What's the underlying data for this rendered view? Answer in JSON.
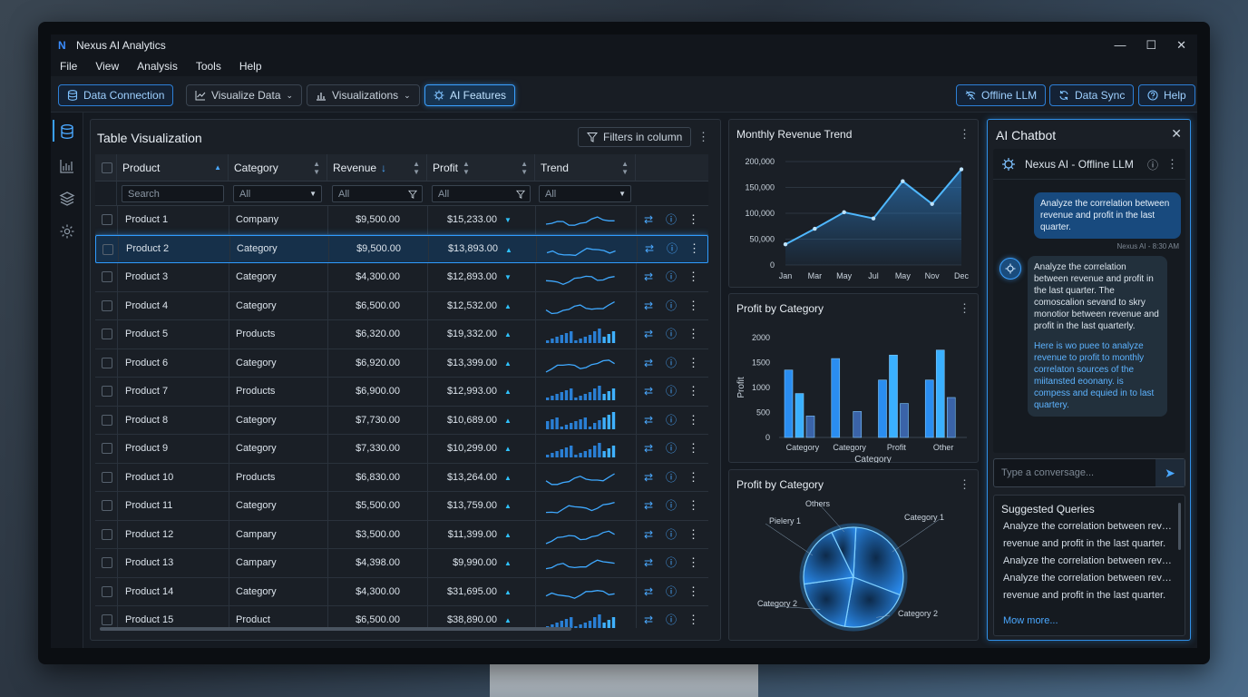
{
  "app": {
    "title": "Nexus AI Analytics",
    "logo_letter": "N"
  },
  "menu": [
    "File",
    "View",
    "Analysis",
    "Tools",
    "Help"
  ],
  "toolbar": {
    "data_connection": "Data Connection",
    "visualize_data": "Visualize Data",
    "visualizations": "Visualizations",
    "ai_features": "AI Features",
    "offline_llm": "Offline LLM",
    "data_sync": "Data Sync",
    "help": "Help"
  },
  "table": {
    "title": "Table Visualization",
    "filters_label": "Filters in column",
    "columns": [
      "Product",
      "Category",
      "Revenue",
      "Profit",
      "Trend"
    ],
    "filters": {
      "product_placeholder": "Search",
      "category": "All",
      "revenue": "All",
      "profit": "All",
      "trend": "All"
    },
    "rows": [
      {
        "product": "Product 1",
        "category": "Company",
        "revenue": "$9,500.00",
        "profit": "$15,233.00",
        "dir": "down",
        "spark": "line",
        "selected": false
      },
      {
        "product": "Product 2",
        "category": "Category",
        "revenue": "$9,500.00",
        "profit": "$13,893.00",
        "dir": "up",
        "spark": "line",
        "selected": true
      },
      {
        "product": "Product 3",
        "category": "Category",
        "revenue": "$4,300.00",
        "profit": "$12,893.00",
        "dir": "down",
        "spark": "line",
        "selected": false
      },
      {
        "product": "Product 4",
        "category": "Category",
        "revenue": "$6,500.00",
        "profit": "$12,532.00",
        "dir": "up",
        "spark": "line",
        "selected": false
      },
      {
        "product": "Product 5",
        "category": "Products",
        "revenue": "$6,320.00",
        "profit": "$19,332.00",
        "dir": "up",
        "spark": "bar",
        "selected": false
      },
      {
        "product": "Product 6",
        "category": "Category",
        "revenue": "$6,920.00",
        "profit": "$13,399.00",
        "dir": "up",
        "spark": "line",
        "selected": false
      },
      {
        "product": "Product 7",
        "category": "Products",
        "revenue": "$6,900.00",
        "profit": "$12,993.00",
        "dir": "up",
        "spark": "bar",
        "selected": false
      },
      {
        "product": "Product 8",
        "category": "Category",
        "revenue": "$7,730.00",
        "profit": "$10,689.00",
        "dir": "up",
        "spark": "bar",
        "selected": false
      },
      {
        "product": "Product 9",
        "category": "Category",
        "revenue": "$7,330.00",
        "profit": "$10,299.00",
        "dir": "up",
        "spark": "bar",
        "selected": false
      },
      {
        "product": "Product 10",
        "category": "Products",
        "revenue": "$6,830.00",
        "profit": "$13,264.00",
        "dir": "up",
        "spark": "line",
        "selected": false
      },
      {
        "product": "Product 11",
        "category": "Category",
        "revenue": "$5,500.00",
        "profit": "$13,759.00",
        "dir": "up",
        "spark": "line",
        "selected": false
      },
      {
        "product": "Product 12",
        "category": "Campary",
        "revenue": "$3,500.00",
        "profit": "$11,399.00",
        "dir": "up",
        "spark": "line",
        "selected": false
      },
      {
        "product": "Product 13",
        "category": "Campary",
        "revenue": "$4,398.00",
        "profit": "$9,990.00",
        "dir": "up",
        "spark": "line",
        "selected": false
      },
      {
        "product": "Product 14",
        "category": "Category",
        "revenue": "$4,300.00",
        "profit": "$31,695.00",
        "dir": "up",
        "spark": "line",
        "selected": false
      },
      {
        "product": "Product 15",
        "category": "Product",
        "revenue": "$6,500.00",
        "profit": "$38,890.00",
        "dir": "up",
        "spark": "bar",
        "selected": false
      }
    ]
  },
  "chart_data": [
    {
      "type": "area",
      "title": "Monthly Revenue Trend",
      "categories": [
        "Jan",
        "Mar",
        "May",
        "Jul",
        "May",
        "Nov",
        "Dec"
      ],
      "tick_labels": [
        "Jan",
        "Mar",
        "May",
        "Jul",
        "May",
        "Nov",
        "Dec"
      ],
      "values": [
        40000,
        70000,
        102000,
        90000,
        162000,
        118000,
        185000
      ],
      "ylim": [
        0,
        200000
      ],
      "yticks": [
        "200,000",
        "150,000",
        "100,000",
        "50,000",
        "0"
      ],
      "grid": true
    },
    {
      "type": "bar",
      "title": "Profit by Category",
      "xlabel": "Category",
      "ylabel": "Profit",
      "categories": [
        "Category",
        "Category",
        "Profit",
        "Other"
      ],
      "series": [
        {
          "values": [
            1350,
            1580,
            1150,
            1150
          ]
        },
        {
          "values": [
            880,
            0,
            1650,
            1750
          ]
        },
        {
          "values": [
            430,
            520,
            680,
            800
          ]
        }
      ],
      "ylim": [
        0,
        2000
      ],
      "yticks": [
        "2000",
        "1500",
        "1000",
        "500",
        "0"
      ]
    },
    {
      "type": "pie",
      "title": "Profit by Category",
      "labels": [
        "Category 1",
        "Category 2",
        "Category 2",
        "Pielery 1",
        "Others"
      ],
      "values": [
        30,
        22,
        20,
        20,
        8
      ]
    }
  ],
  "chat": {
    "title": "AI Chatbot",
    "bot_name": "Nexus AI - Offline LLM",
    "user_message": "Analyze the correlation between revenue and profit in the last quarter.",
    "timestamp": "Nexus AI - 8:30 AM",
    "bot_message_1": "Analyze the correlation between revenue and profit in the last quarter. The comoscalion sevand to skry monotior between revenue and profit in the last quarterly.",
    "bot_message_2": "Here is wo puee to analyze revenue to profit to monthly correlaton sources of the miitansted eoonany. is compess and equied in to last quartery.",
    "input_placeholder": "Type a conversage...",
    "suggested_title": "Suggested Queries",
    "suggested": [
      "Analyze the correlation between revenue",
      "revenue and profit in the last quarter.",
      "Analyze the correlation between revenue",
      "Analyze the correlation between revenue",
      "revenue and profit in the last quarter."
    ],
    "more": "Mow more..."
  },
  "colors": {
    "accent": "#3aa0ff",
    "panel": "#1a1f26",
    "bg": "#151a21"
  }
}
